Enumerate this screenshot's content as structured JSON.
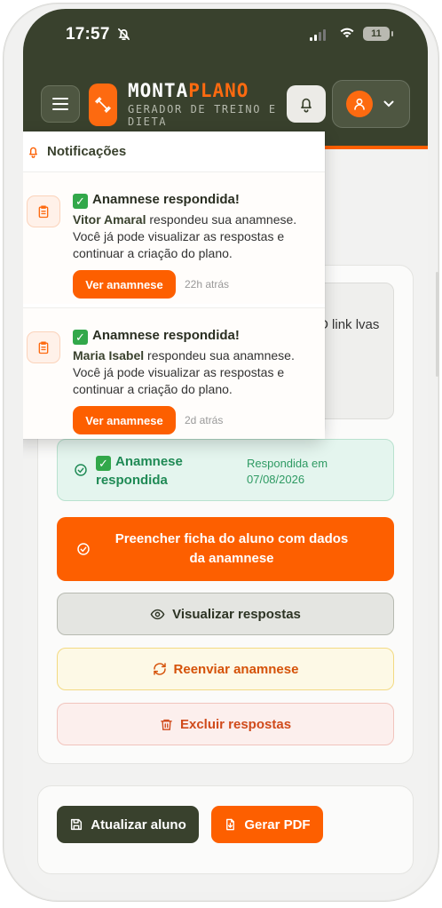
{
  "status_bar": {
    "time": "17:57",
    "battery": "11"
  },
  "header": {
    "brand_part1": "MONTA",
    "brand_part2": "PLANO",
    "tagline": "GERADOR DE TREINO E DIETA"
  },
  "info_box": {
    "text": "ntes de ar. O link lvas no."
  },
  "status": {
    "title": "Anamnese respondida",
    "date": "Respondida em 07/08/2026",
    "color": "#1f8a55"
  },
  "actions": {
    "fill_form": "Preencher ficha do aluno com dados da anamnese",
    "view": "Visualizar respostas",
    "resend": "Reenviar anamnese",
    "delete": "Excluir respostas"
  },
  "footer": {
    "update": "Atualizar aluno",
    "pdf": "Gerar PDF"
  },
  "notifications": {
    "title": "Notificações",
    "items": [
      {
        "title": "Anamnese respondida!",
        "name": "Vitor Amaral",
        "message": " respondeu sua anamnese. Você já pode visualizar as respostas e continuar a criação do plano.",
        "button": "Ver anamnese",
        "time": "22h atrás"
      },
      {
        "title": "Anamnese respondida!",
        "name": "Maria Isabel",
        "message": " respondeu sua anamnese. Você já pode visualizar as respostas e continuar a criação do plano.",
        "button": "Ver anamnese",
        "time": "2d atrás"
      }
    ]
  },
  "colors": {
    "primary": "#fd5f00",
    "dark": "#39412d",
    "success": "#1f8a55"
  }
}
